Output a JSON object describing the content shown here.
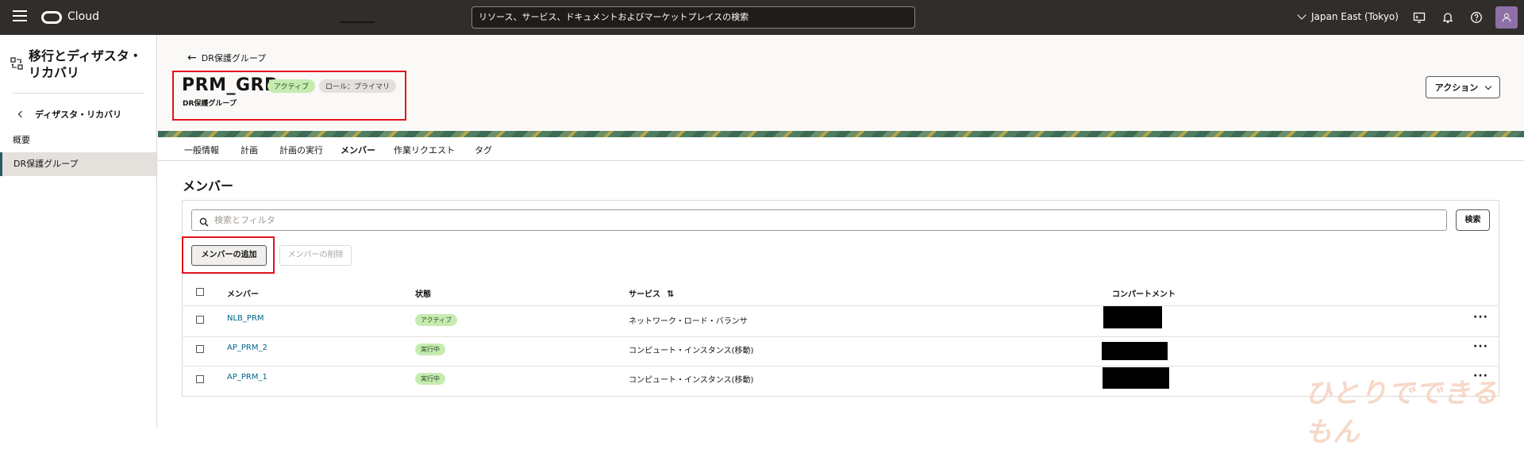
{
  "topbar": {
    "brand": "Cloud",
    "search_placeholder": "リソース、サービス、ドキュメントおよびマーケットプレイスの検索",
    "region": "Japan East (Tokyo)"
  },
  "sidebar": {
    "title": "移行とディザスタ・リカバリ",
    "back_label": "ディザスタ・リカバリ",
    "items": [
      {
        "label": "概要",
        "active": false
      },
      {
        "label": "DR保護グループ",
        "active": true
      }
    ]
  },
  "header": {
    "back_link": "DR保護グループ",
    "title": "PRM_GRP",
    "status_badge": "アクティブ",
    "role_badge": "ロール：プライマリ",
    "subtitle": "DR保護グループ",
    "action_button": "アクション"
  },
  "tabs": [
    {
      "label": "一般情報"
    },
    {
      "label": "計画"
    },
    {
      "label": "計画の実行"
    },
    {
      "label": "メンバー",
      "active": true
    },
    {
      "label": "作業リクエスト"
    },
    {
      "label": "タグ"
    }
  ],
  "members": {
    "section_title": "メンバー",
    "filter_placeholder": "検索とフィルタ",
    "search_button": "検索",
    "add_button": "メンバーの追加",
    "remove_button": "メンバーの削除",
    "columns": {
      "member": "メンバー",
      "state": "状態",
      "service": "サービス",
      "compartment": "コンパートメント"
    },
    "rows": [
      {
        "member": "NLB_PRM",
        "state": "アクティブ",
        "service": "ネットワーク・ロード・バランサ",
        "compartment": ""
      },
      {
        "member": "AP_PRM_2",
        "state": "実行中",
        "service": "コンピュート・インスタンス(移動)",
        "compartment": ""
      },
      {
        "member": "AP_PRM_1",
        "state": "実行中",
        "service": "コンピュート・インスタンス(移動)",
        "compartment": ""
      }
    ],
    "row_menu": "···"
  },
  "watermark": "ひとりでできるもん",
  "colors": {
    "topbar": "#312d2a",
    "link": "#00688c",
    "highlight_box": "#e1141c",
    "badge_green": "#c6ebb1"
  }
}
